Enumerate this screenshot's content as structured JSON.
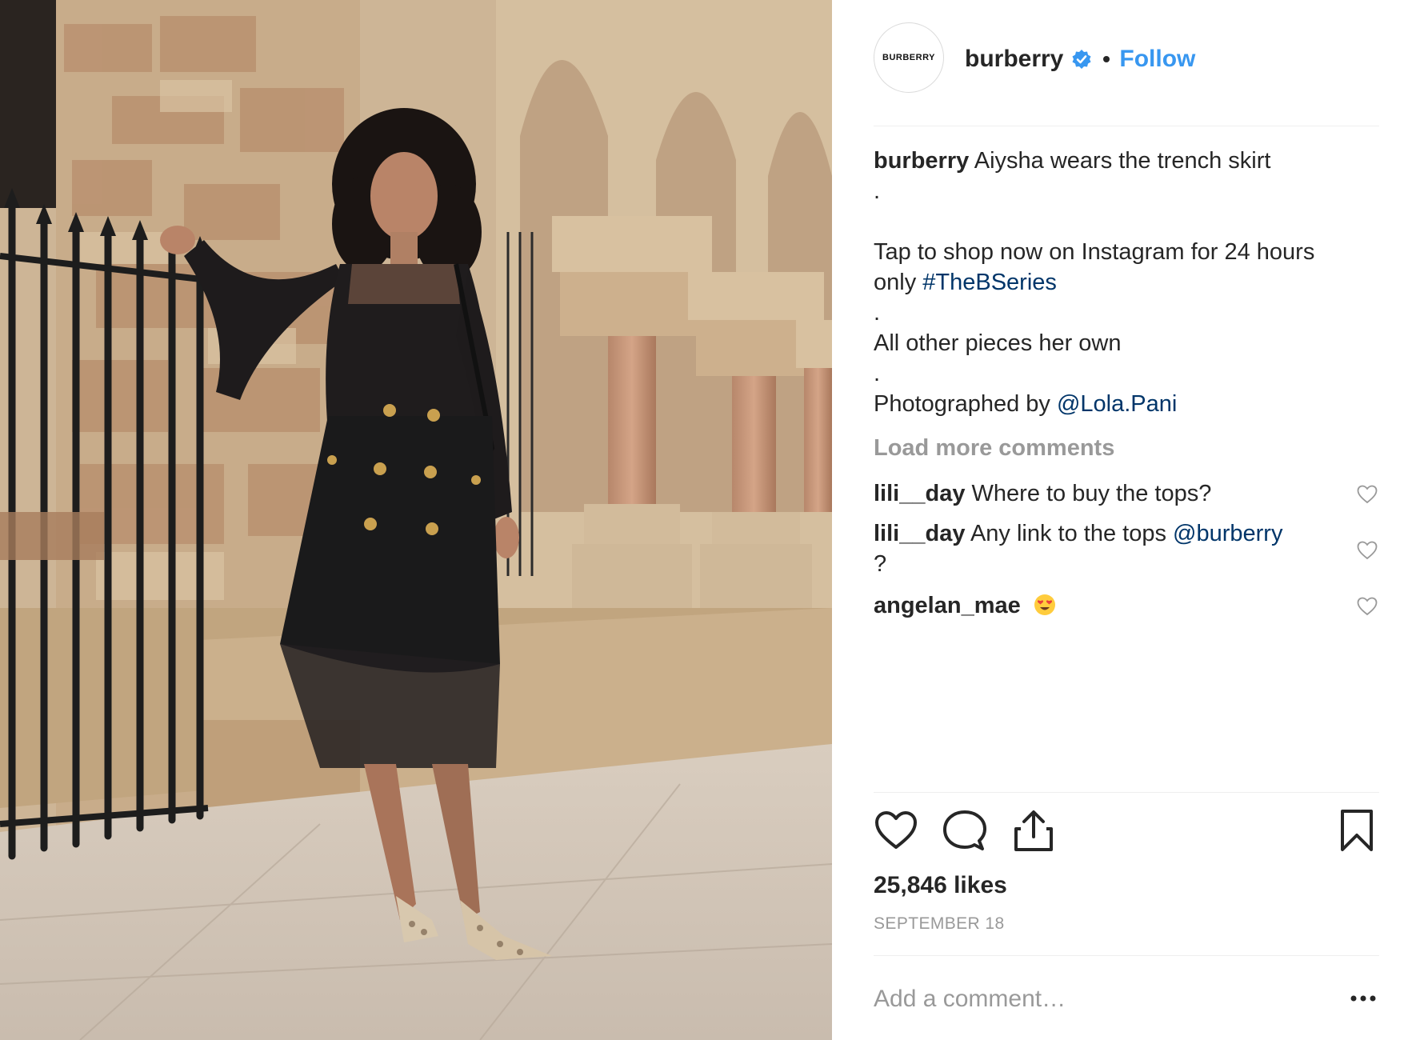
{
  "colors": {
    "link_blue": "#3897f0",
    "hashtag": "#003569",
    "muted": "#999999",
    "text": "#262626",
    "divider": "#efefef"
  },
  "post": {
    "image_description_icon": "photo",
    "author": {
      "avatar_text": "BURBERRY",
      "username": "burberry",
      "verified_icon": "verified-badge-icon",
      "follow_label": "Follow"
    },
    "caption": {
      "username": "burberry",
      "text": "Aiysha wears the trench skirt",
      "dot1": ".",
      "line2": "Tap to shop now on Instagram for 24 hours",
      "line3_prefix": "only",
      "hashtag": "#TheBSeries",
      "dot2": ".",
      "line4": "All other pieces her own",
      "dot3": ".",
      "line5_prefix": "Photographed by",
      "mention": "@Lola.Pani"
    },
    "load_more_label": "Load more comments",
    "comments": [
      {
        "username": "lili__day",
        "text": "Where to buy the tops?"
      },
      {
        "username": "lili__day",
        "text": "Any link to the tops",
        "mention": "@burberry",
        "trailing": "?"
      },
      {
        "username": "angelan_mae",
        "emoji": "heart-eyes-emoji"
      }
    ],
    "likes_text": "25,846 likes",
    "date_text": "SEPTEMBER 18",
    "add_comment_placeholder": "Add a comment…",
    "icons": [
      "heart-icon",
      "comment-icon",
      "share-icon",
      "bookmark-icon",
      "more-options-icon"
    ]
  }
}
